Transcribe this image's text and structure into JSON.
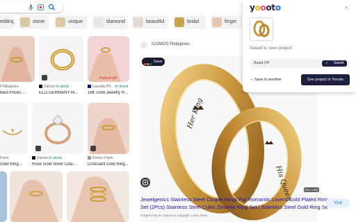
{
  "search": {
    "icons": [
      "mic-icon",
      "lens-icon",
      "search-icon"
    ]
  },
  "chips": [
    {
      "label": "edding"
    },
    {
      "label": "stone"
    },
    {
      "label": "unique"
    },
    {
      "label": "diamond"
    },
    {
      "label": "beautiful"
    },
    {
      "label": "bridal"
    },
    {
      "label": "finger"
    }
  ],
  "grid": {
    "tiles": [
      {
        "source": "Philippines",
        "title": "Best Prices ..."
      },
      {
        "source": "Zalora",
        "stock": "In stock",
        "title": "ELLI GERMANY Ri..."
      },
      {
        "source": "Lazada Ph...",
        "stock": "In stock",
        "title": "18K Gold Jewelry R..."
      },
      {
        "source": "Paris",
        "title": "Gold Ring..."
      },
      {
        "source": "Zalora",
        "stock": "In stock",
        "title": "Rose Gold Silver Cow..."
      },
      {
        "source": "Perles Paris",
        "title": "Croissant Gold Ring..."
      }
    ],
    "price_tag": "Thebest gift"
  },
  "detail": {
    "source_name": "ICOMOS Philippines",
    "save_label": "Save",
    "dim_badge": "600 × 600",
    "description_line1": "Jewelgenics Stainless Steel Couple Rings For Romantic Lovers Gold Plated Ring",
    "description_line2": "Set (2Pcs) Stainless Steel Cubic Zirconia Ring Set | Stainless Steel Gold Ring Set...",
    "copyright": "Images may be subject to copyright. Learn More",
    "visit_label": "Visit",
    "ring_engravings": [
      "Her King",
      "His Queen"
    ]
  },
  "popup": {
    "logo": "yoooto",
    "close_label": "×",
    "saved_message": "Saved to new project",
    "board_name": "Board OH",
    "saved_status": "Saved",
    "save_another_label": "Save to another",
    "see_project_label": "See project in Yoooto",
    "brand_colors": {
      "navy": "#1c1f3f",
      "o1": "#f4b400",
      "o2": "#e8467c",
      "o3": "#1a73e8"
    }
  }
}
